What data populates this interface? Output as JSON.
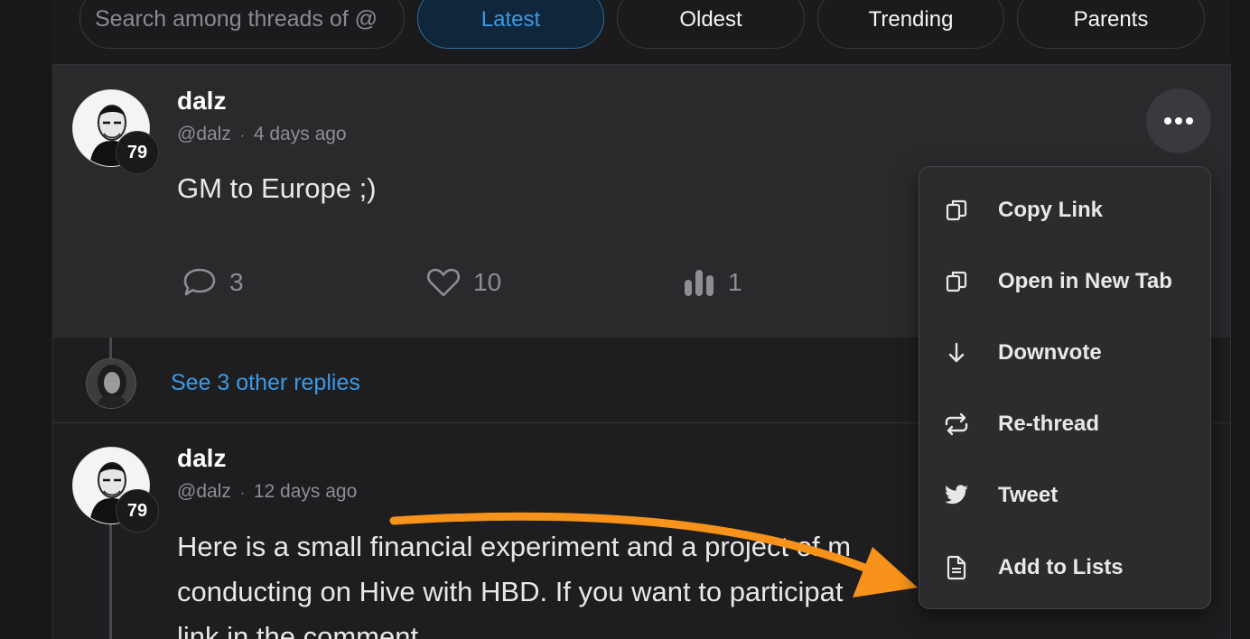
{
  "search": {
    "placeholder": "Search among threads of @"
  },
  "tabs": [
    {
      "label": "Latest",
      "active": true
    },
    {
      "label": "Oldest",
      "active": false
    },
    {
      "label": "Trending",
      "active": false
    },
    {
      "label": "Parents",
      "active": false
    }
  ],
  "thread1": {
    "username": "dalz",
    "handle": "@dalz",
    "separator": "·",
    "time": "4 days ago",
    "reputation": "79",
    "text": "GM to Europe ;)",
    "stats": {
      "comments": "3",
      "likes": "10",
      "votes": "1"
    }
  },
  "replies_link": "See 3 other replies",
  "thread2": {
    "username": "dalz",
    "handle": "@dalz",
    "separator": "·",
    "time": "12 days ago",
    "reputation": "79",
    "line1": "Here is a small financial experiment and a project of m",
    "line2": "conducting on Hive with HBD. If you want to participat",
    "line3": "link in the comment."
  },
  "menu": {
    "items": [
      {
        "label": "Copy Link",
        "icon": "copy-icon"
      },
      {
        "label": "Open in New Tab",
        "icon": "copy-icon"
      },
      {
        "label": "Downvote",
        "icon": "arrow-down-icon"
      },
      {
        "label": "Re-thread",
        "icon": "repeat-icon"
      },
      {
        "label": "Tweet",
        "icon": "twitter-icon"
      },
      {
        "label": "Add to Lists",
        "icon": "document-icon"
      }
    ]
  },
  "colors": {
    "accent": "#3a9ae6",
    "annotation_arrow": "#f7931a"
  }
}
